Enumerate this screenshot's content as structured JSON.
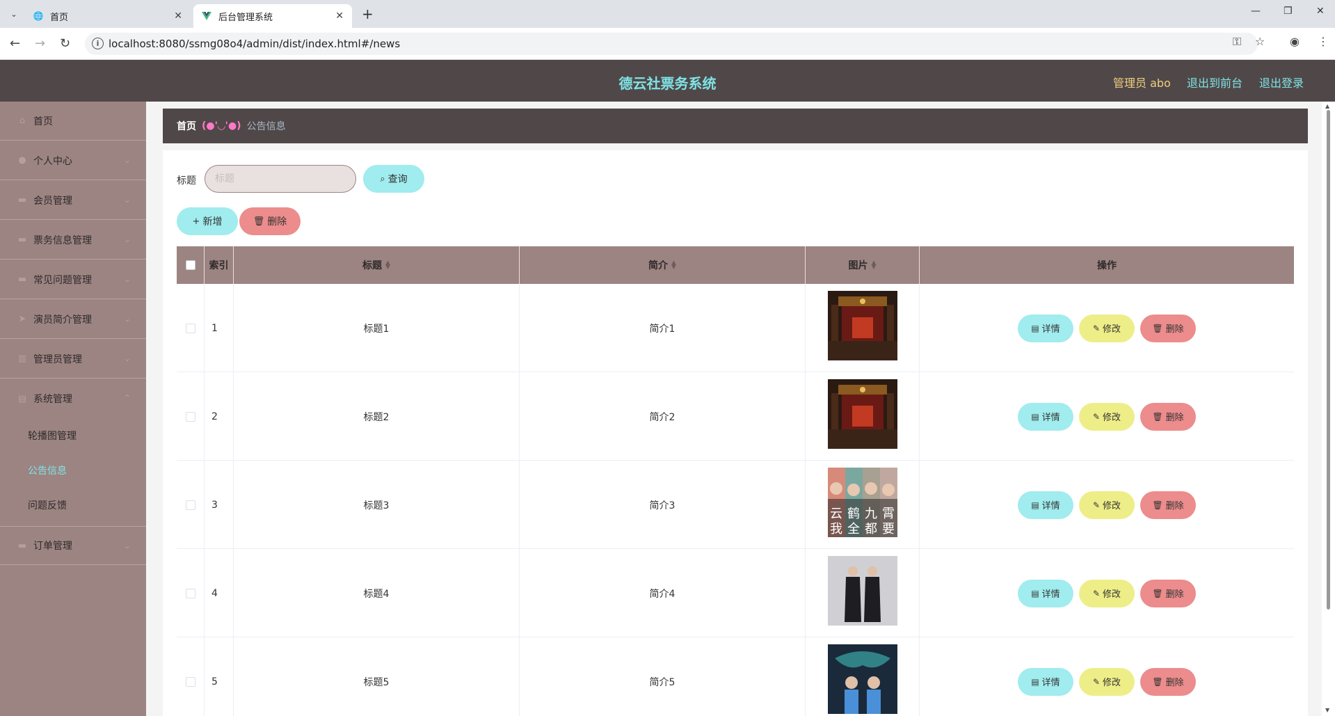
{
  "browser": {
    "tabs": [
      {
        "title": "首页",
        "active": false
      },
      {
        "title": "后台管理系统",
        "active": true
      }
    ],
    "url": "localhost:8080/ssmg08o4/admin/dist/index.html#/news"
  },
  "header": {
    "title": "德云社票务系统",
    "admin_label": "管理员 abo",
    "exit_front": "退出到前台",
    "logout": "退出登录",
    "colors": {
      "title": "#7fe3e6",
      "admin": "#f0d080",
      "links": "#7fe3e6",
      "bg": "#504848"
    }
  },
  "sidebar": {
    "items": [
      {
        "label": "首页",
        "icon": "home-icon",
        "has_arrow": false
      },
      {
        "label": "个人中心",
        "icon": "user-icon",
        "has_arrow": true
      },
      {
        "label": "会员管理",
        "icon": "members-icon",
        "has_arrow": true
      },
      {
        "label": "票务信息管理",
        "icon": "ticket-icon",
        "has_arrow": true
      },
      {
        "label": "常见问题管理",
        "icon": "question-icon",
        "has_arrow": true
      },
      {
        "label": "演员简介管理",
        "icon": "send-icon",
        "has_arrow": true
      },
      {
        "label": "管理员管理",
        "icon": "chart-icon",
        "has_arrow": true
      },
      {
        "label": "系统管理",
        "icon": "system-icon",
        "has_arrow": true,
        "expanded": true
      }
    ],
    "sub_items": [
      {
        "label": "轮播图管理",
        "active": false
      },
      {
        "label": "公告信息",
        "active": true
      },
      {
        "label": "问题反馈",
        "active": false
      }
    ],
    "last_item": {
      "label": "订单管理",
      "icon": "order-icon"
    }
  },
  "breadcrumb": {
    "home": "首页",
    "separator": "(●'◡'●)",
    "current": "公告信息"
  },
  "search": {
    "label": "标题",
    "placeholder": "标题",
    "value": "",
    "query_button": "查询"
  },
  "actions": {
    "add": "新增",
    "delete": "删除"
  },
  "table": {
    "columns": [
      "索引",
      "标题",
      "简介",
      "图片",
      "操作"
    ],
    "rows": [
      {
        "index": "1",
        "title": "标题1",
        "intro": "简介1",
        "image": "theater-stage"
      },
      {
        "index": "2",
        "title": "标题2",
        "intro": "简介2",
        "image": "theater-stage"
      },
      {
        "index": "3",
        "title": "标题3",
        "intro": "简介3",
        "image": "poster-four-performers"
      },
      {
        "index": "4",
        "title": "标题4",
        "intro": "简介4",
        "image": "two-performers-robes"
      },
      {
        "index": "5",
        "title": "标题5",
        "intro": "简介5",
        "image": "two-performers-stage"
      }
    ],
    "row_actions": {
      "detail": "详情",
      "edit": "修改",
      "delete": "删除"
    },
    "poster_chars": [
      "云",
      "鹤",
      "九",
      "霄",
      "我",
      "全",
      "都",
      "要"
    ]
  }
}
